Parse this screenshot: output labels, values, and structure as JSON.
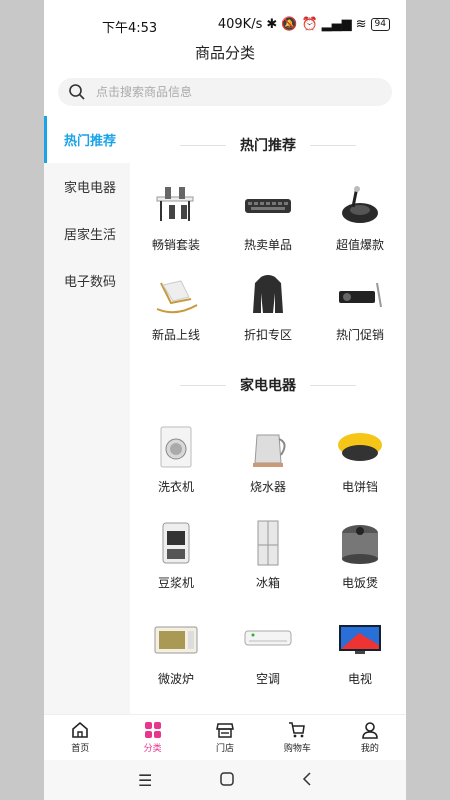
{
  "status": {
    "time": "下午4:53",
    "speed": "409K/s",
    "battery": "94"
  },
  "header": {
    "title": "商品分类"
  },
  "search": {
    "placeholder": "点击搜索商品信息"
  },
  "sidebar": {
    "items": [
      {
        "label": "热门推荐",
        "active": true
      },
      {
        "label": "家电电器",
        "active": false
      },
      {
        "label": "居家生活",
        "active": false
      },
      {
        "label": "电子数码",
        "active": false
      }
    ]
  },
  "sections": [
    {
      "title": "热门推荐",
      "items": [
        {
          "label": "畅销套装",
          "icon": "dining-set-icon"
        },
        {
          "label": "热卖单品",
          "icon": "keyboard-icon"
        },
        {
          "label": "超值爆款",
          "icon": "robot-vacuum-icon"
        },
        {
          "label": "新品上线",
          "icon": "rocking-chair-icon"
        },
        {
          "label": "折扣专区",
          "icon": "jacket-icon"
        },
        {
          "label": "热门促销",
          "icon": "projector-icon"
        }
      ]
    },
    {
      "title": "家电电器",
      "items": [
        {
          "label": "洗衣机",
          "icon": "washing-machine-icon"
        },
        {
          "label": "烧水器",
          "icon": "kettle-icon"
        },
        {
          "label": "电饼铛",
          "icon": "griddle-icon"
        },
        {
          "label": "豆浆机",
          "icon": "soymilk-maker-icon"
        },
        {
          "label": "冰箱",
          "icon": "fridge-icon"
        },
        {
          "label": "电饭煲",
          "icon": "rice-cooker-icon"
        },
        {
          "label": "微波炉",
          "icon": "microwave-icon"
        },
        {
          "label": "空调",
          "icon": "air-conditioner-icon"
        },
        {
          "label": "电视",
          "icon": "tv-icon"
        }
      ]
    }
  ],
  "tabbar": {
    "items": [
      {
        "label": "首页",
        "icon": "home-icon"
      },
      {
        "label": "分类",
        "icon": "category-icon",
        "active": true
      },
      {
        "label": "门店",
        "icon": "store-icon"
      },
      {
        "label": "购物车",
        "icon": "cart-icon"
      },
      {
        "label": "我的",
        "icon": "profile-icon"
      }
    ]
  },
  "colors": {
    "accent": "#1aa3e8",
    "tab_active": "#e8358e"
  }
}
